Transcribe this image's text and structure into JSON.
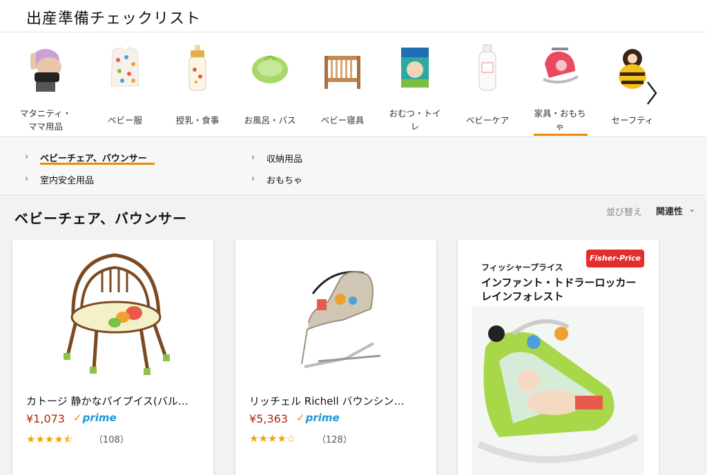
{
  "header": {
    "title": "出産準備チェックリスト"
  },
  "categories": [
    {
      "label": "マタニティ・ママ用品",
      "lines": [
        "マタニティ・",
        "ママ用品"
      ],
      "icon": "maternity-belt-icon"
    },
    {
      "label": "ベビー服",
      "lines": [
        "ベビー服"
      ],
      "icon": "baby-clothes-icon"
    },
    {
      "label": "授乳・食事",
      "lines": [
        "授乳・食事"
      ],
      "icon": "baby-bottle-icon"
    },
    {
      "label": "お風呂・バス",
      "lines": [
        "お風呂・バス"
      ],
      "icon": "baby-bath-icon"
    },
    {
      "label": "ベビー寝具",
      "lines": [
        "ベビー寝具"
      ],
      "icon": "crib-icon"
    },
    {
      "label": "おむつ・トイレ",
      "lines": [
        "おむつ・トイ",
        "レ"
      ],
      "icon": "diaper-pack-icon"
    },
    {
      "label": "ベビーケア",
      "lines": [
        "ベビーケア"
      ],
      "icon": "lotion-bottle-icon"
    },
    {
      "label": "家具・おもちゃ",
      "lines": [
        "家具・おもち",
        "ゃ"
      ],
      "icon": "bouncer-icon",
      "selected": true
    },
    {
      "label": "セーフティ",
      "lines": [
        "セーフティ"
      ],
      "icon": "bee-cushion-icon"
    }
  ],
  "subnav": {
    "items": [
      {
        "label": "ベビーチェア、バウンサー",
        "active": true
      },
      {
        "label": "収納用品"
      },
      {
        "label": "室内安全用品"
      },
      {
        "label": "おもちゃ"
      }
    ]
  },
  "results": {
    "title": "ベビーチェア、バウンサー",
    "sort_label": "並び替え",
    "sort_value": "関連性",
    "accent_color": "#f08804",
    "price_color": "#b12704",
    "prime_color": "#1a98d5"
  },
  "products": [
    {
      "title": "カトージ 静かなパイプイス(バル…",
      "price": "¥1,073",
      "prime": "prime",
      "rating": 4.5,
      "stars": "★★★★⯪",
      "count": "（108）",
      "image": "baby-pipe-chair-image"
    },
    {
      "title": "リッチェル Richell バウンシン…",
      "price": "¥5,363",
      "prime": "prime",
      "rating": 4,
      "stars": "★★★★☆",
      "count": "（128）",
      "image": "baby-bouncer-image"
    },
    {
      "image": "fisher-price-rocker-image",
      "brand_logo": "Fisher-Price",
      "brand_jp": "フィッシャープライス",
      "name_line1": "インファント・トドラーロッカー",
      "name_line2": "レインフォレスト"
    }
  ]
}
